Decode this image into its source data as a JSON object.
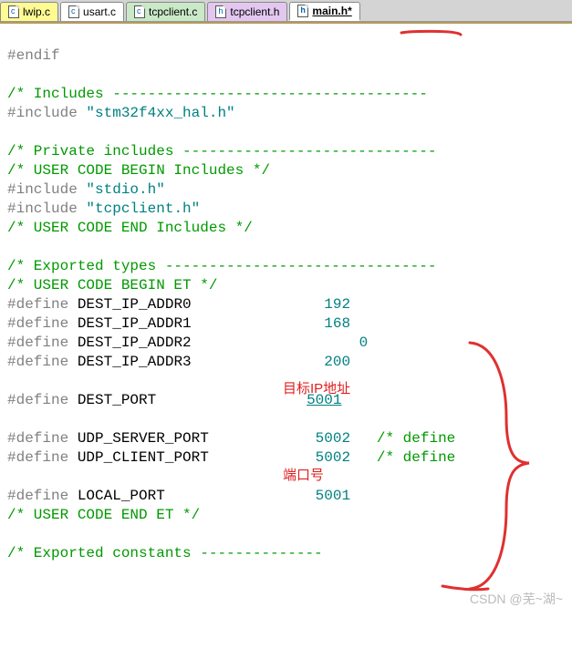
{
  "tabs": [
    {
      "label": "lwip.c"
    },
    {
      "label": "usart.c"
    },
    {
      "label": "tcpclient.c"
    },
    {
      "label": "tcpclient.h"
    },
    {
      "label": "main.h*"
    }
  ],
  "code": {
    "endif": "#endif",
    "inc_hdr": "/* Includes ------------------------------------",
    "inc1_a": "#include ",
    "inc1_b": "\"stm32f4xx_hal.h\"",
    "priv_hdr": "/* Private includes -----------------------------",
    "ucb_inc": "/* USER CODE BEGIN Includes */",
    "inc2_a": "#include ",
    "inc2_b": "\"stdio.h\"",
    "inc3_a": "#include ",
    "inc3_b": "\"tcpclient.h\"",
    "uce_inc": "/* USER CODE END Includes */",
    "exp_hdr": "/* Exported types -------------------------------",
    "ucb_et": "/* USER CODE BEGIN ET */",
    "def": "#define",
    "d_ip0": " DEST_IP_ADDR0              ",
    "v_ip0": "192",
    "d_ip1": " DEST_IP_ADDR1              ",
    "v_ip1": "168",
    "d_ip2": " DEST_IP_ADDR2                ",
    "v_ip2": "0",
    "d_ip3": " DEST_IP_ADDR3              ",
    "v_ip3": "200",
    "d_dport": " DEST_PORT                 ",
    "v_dport": "5001",
    "d_usp": " UDP_SERVER_PORT            ",
    "v_usp": "5002",
    "c_usp": "   /* define",
    "d_ucp": " UDP_CLIENT_PORT            ",
    "v_ucp": "5002",
    "c_ucp": "   /* define",
    "d_lp": " LOCAL_PORT                 ",
    "v_lp": "5001",
    "uce_et": "/* USER CODE END ET */",
    "exp_const": "/* Exported constants --------------"
  },
  "annotations": {
    "target_ip": "目标IP地址",
    "port_no": "端口号"
  },
  "watermark": "CSDN @芜~湖~"
}
